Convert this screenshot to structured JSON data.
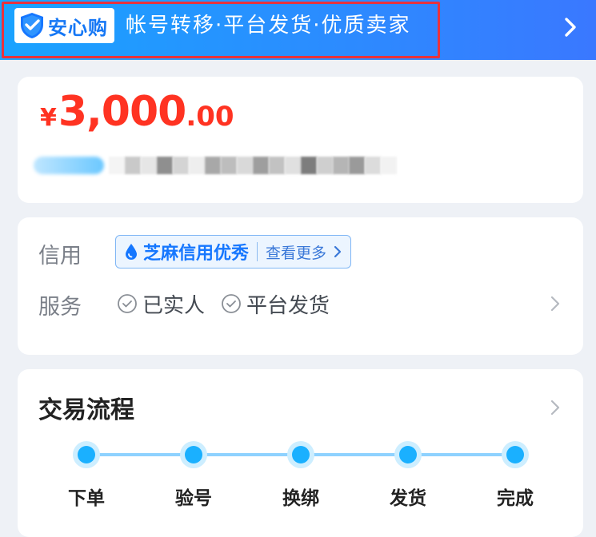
{
  "banner": {
    "badge_text": "安心购",
    "slogan": "帐号转移·平台发货·优质卖家"
  },
  "price": {
    "currency": "¥",
    "integer": "3,000",
    "decimal": ".00",
    "color": "#ff3322"
  },
  "info": {
    "credit_label": "信用",
    "credit_level": "芝麻信用优秀",
    "credit_more": "查看更多",
    "service_label": "服务",
    "services": [
      "已实人",
      "平台发货"
    ]
  },
  "flow": {
    "title": "交易流程",
    "steps": [
      "下单",
      "验号",
      "换绑",
      "发货",
      "完成"
    ]
  },
  "colors": {
    "accent": "#1677ff",
    "banner": "#2b8cff",
    "step_dot": "#1ab0ff"
  }
}
